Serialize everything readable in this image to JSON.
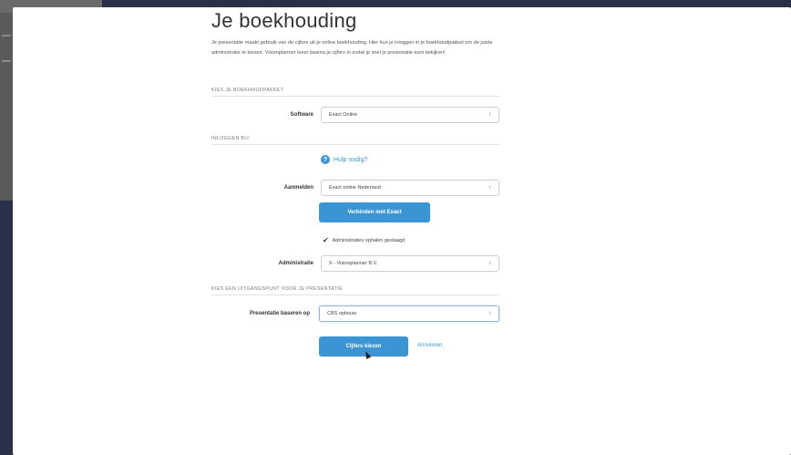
{
  "page": {
    "title": "Je boekhouding",
    "intro": "Je presentatie maakt gebruik van de cijfers uit je online boekhouding. Hier kun je inloggen in je boekhoudpakket om de juiste administratie te kiezen. Visionplanner leest daarna je cijfers in zodat je snel je presentatie kunt bekijken!"
  },
  "section1": {
    "heading": "KIES JE BOEKHOUDPAKKET",
    "software_label": "Software",
    "software_value": "Exact Online"
  },
  "section2": {
    "heading": "INLOGGEN BIJ",
    "help_label": "Hulp nodig?",
    "aanmelden_label": "Aanmelden",
    "aanmelden_value": "Exact online Nederland",
    "connect_button": "Verbinden met Exact",
    "success_text": "Administraties ophalen geslaagd",
    "administratie_label": "Administratie",
    "administratie_value": "X - Visionplanner B.V."
  },
  "section3": {
    "heading": "KIES EEN UITGANGSPUNT VOOR JE PRESENTATIE",
    "presentatie_label": "Presentatie baseren op",
    "presentatie_value": "CBS opbouw",
    "submit_button": "Cijfers kiezen",
    "cancel_link": "Annuleren"
  },
  "icons": {
    "caret": "↕",
    "help": "?",
    "check": "✔"
  },
  "colors": {
    "accent": "#3a95d2",
    "background": "#2b2f4a"
  }
}
